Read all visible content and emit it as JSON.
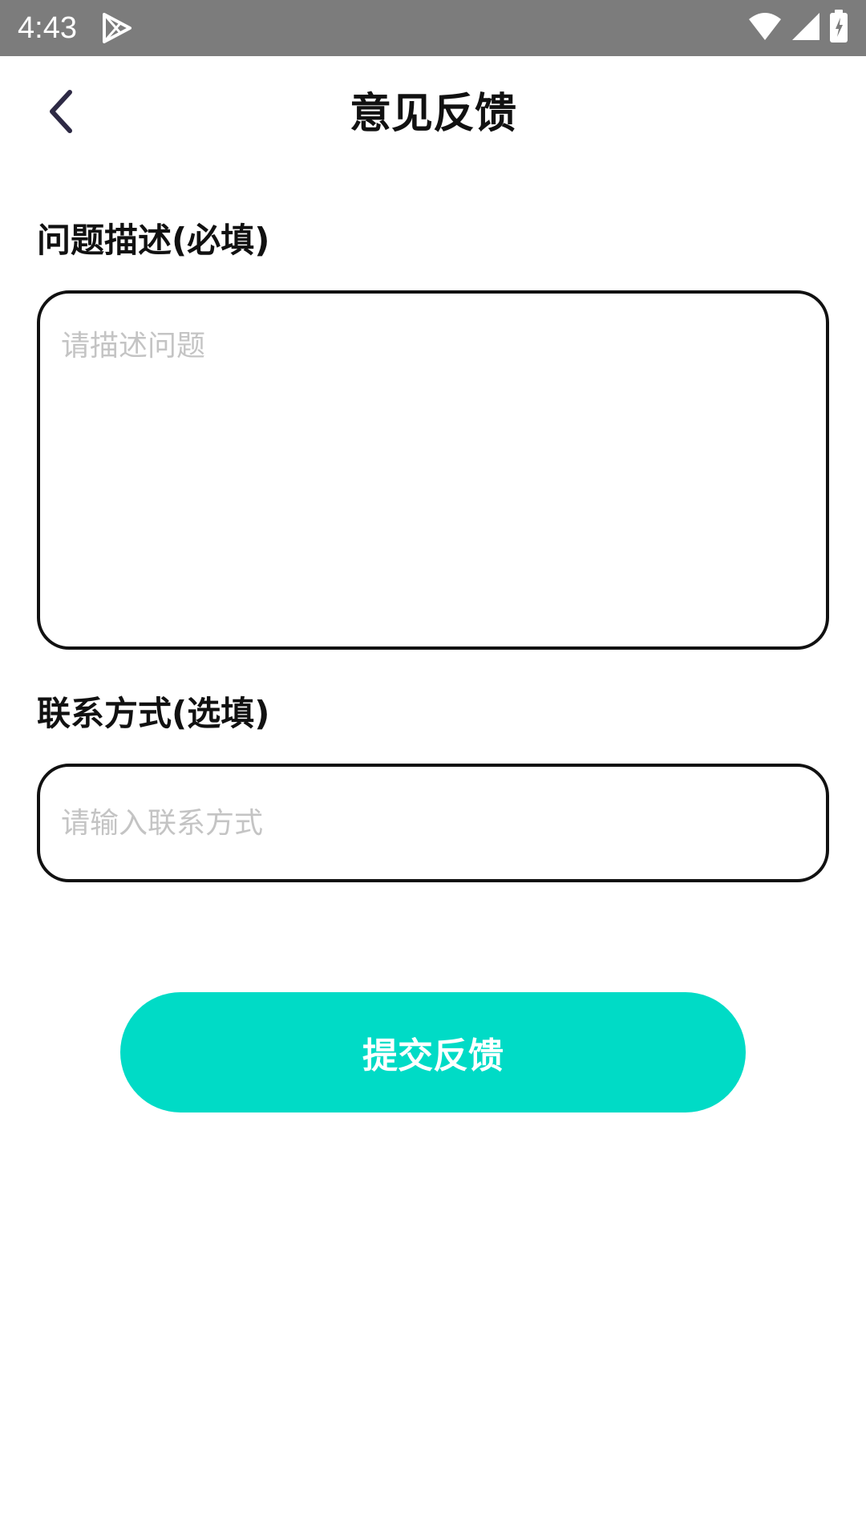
{
  "status_bar": {
    "time": "4:43",
    "icons": [
      "play-store-icon",
      "wifi-icon",
      "cellular-signal-icon",
      "battery-icon"
    ]
  },
  "app_bar": {
    "back_icon": "chevron-left-icon",
    "title": "意见反馈"
  },
  "form": {
    "description": {
      "label": "问题描述(必填)",
      "placeholder": "请描述问题",
      "value": ""
    },
    "contact": {
      "label": "联系方式(选填)",
      "placeholder": "请输入联系方式",
      "value": ""
    },
    "submit_label": "提交反馈"
  },
  "colors": {
    "status_bar": "#7c7c7c",
    "accent": "#00dbc6",
    "text": "#111111",
    "placeholder": "#c4c4c4",
    "back_icon": "#2e2a45"
  }
}
